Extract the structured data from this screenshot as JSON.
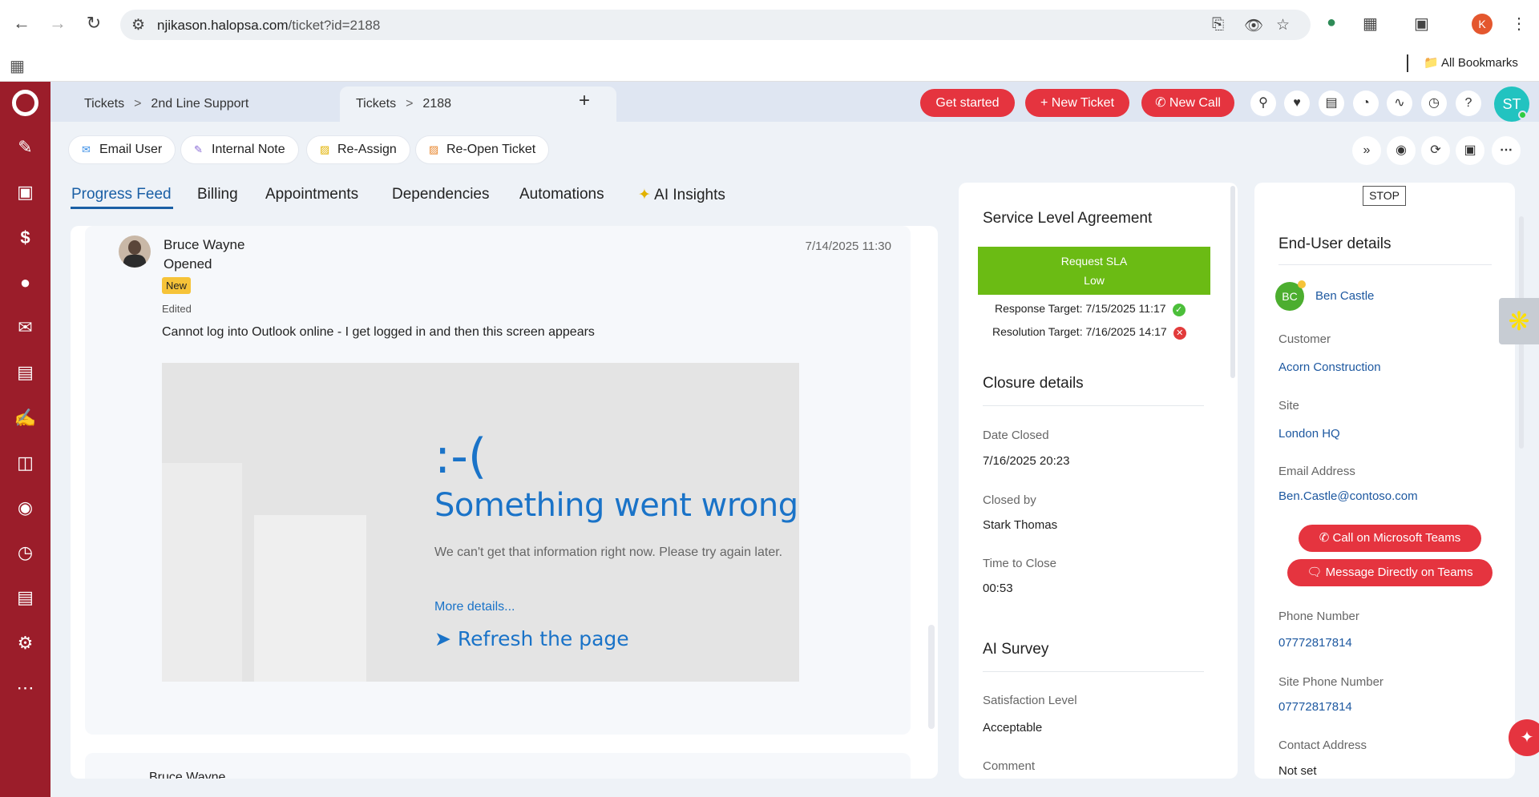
{
  "browser": {
    "url_host": "njikason.halopsa.com",
    "url_path": "/ticket?id=2188",
    "profile_initial": "K",
    "bookmarks_label": "All Bookmarks"
  },
  "header": {
    "tabs": [
      {
        "part1": "Tickets",
        "part2": "2nd Line Support"
      },
      {
        "part1": "Tickets",
        "part2": "2188"
      }
    ],
    "add_tab": "+",
    "get_started": "Get started",
    "new_ticket": "New Ticket",
    "new_call": "New Call",
    "avatar": "ST"
  },
  "actions": {
    "email_user": "Email User",
    "internal_note": "Internal Note",
    "reassign": "Re-Assign",
    "reopen": "Re-Open Ticket"
  },
  "content_tabs": [
    "Progress Feed",
    "Billing",
    "Appointments",
    "Dependencies",
    "Automations",
    "AI Insights"
  ],
  "feed": {
    "name": "Bruce Wayne",
    "action": "Opened",
    "date": "7/14/2025 11:30",
    "badge": "New",
    "edited": "Edited",
    "message": "Cannot log into Outlook online - I get logged in and then this screen appears",
    "screenshot": {
      "frown": ":-(",
      "title": "Something went wrong",
      "subtitle": "We can't get that information right now. Please try again later.",
      "more": "More details...",
      "refresh": "Refresh the page"
    },
    "next_name": "Bruce Wayne"
  },
  "sla": {
    "title": "Service Level Agreement",
    "box_line1": "Request SLA",
    "box_line2": "Low",
    "response": "Response Target: 7/15/2025 11:17",
    "resolution": "Resolution Target: 7/16/2025 14:17",
    "closure_title": "Closure details",
    "date_closed_label": "Date Closed",
    "date_closed": "7/16/2025 20:23",
    "closed_by_label": "Closed by",
    "closed_by": "Stark Thomas",
    "time_to_close_label": "Time to Close",
    "time_to_close": "00:53",
    "survey_title": "AI Survey",
    "satisfaction_label": "Satisfaction Level",
    "satisfaction": "Acceptable",
    "comment_label": "Comment"
  },
  "enduser": {
    "stop": "STOP",
    "title": "End-User details",
    "initials": "BC",
    "name": "Ben Castle",
    "customer_label": "Customer",
    "customer": "Acorn Construction",
    "site_label": "Site",
    "site": "London HQ",
    "email_label": "Email Address",
    "email": "Ben.Castle@contoso.com",
    "call_teams": "Call on Microsoft Teams",
    "message_teams": "Message Directly on Teams",
    "phone_label": "Phone Number",
    "phone": "07772817814",
    "site_phone_label": "Site Phone Number",
    "site_phone": "07772817814",
    "contact_address_label": "Contact Address",
    "contact_address": "Not set"
  }
}
